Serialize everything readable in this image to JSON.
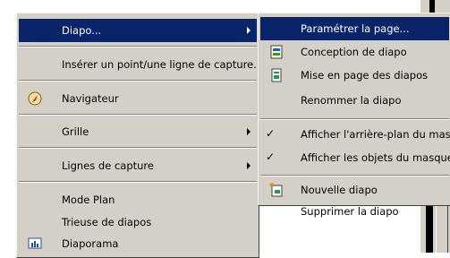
{
  "main_menu": {
    "items": [
      {
        "label": "Diapo...",
        "has_submenu": true,
        "highlighted": true
      },
      {
        "label": "Insérer un point/une ligne de capture..."
      },
      {
        "label": "Navigateur",
        "icon": "navigator-compass-icon"
      },
      {
        "label": "Grille",
        "has_submenu": true
      },
      {
        "label": "Lignes de capture",
        "has_submenu": true
      },
      {
        "label": "Mode Plan"
      },
      {
        "label": "Trieuse de diapos"
      },
      {
        "label": "Diaporama",
        "icon": "slideshow-icon"
      }
    ]
  },
  "sub_menu": {
    "items": [
      {
        "label": "Paramétrer la page...",
        "highlighted": true
      },
      {
        "label": "Conception de diapo",
        "icon": "slide-design-icon"
      },
      {
        "label": "Mise en page des diapos",
        "icon": "slide-layout-icon"
      },
      {
        "label": "Renommer la diapo"
      },
      {
        "label": "Afficher l'arrière-plan du masque",
        "checked": true
      },
      {
        "label": "Afficher les objets du masque",
        "checked": true
      },
      {
        "label": "Nouvelle diapo",
        "icon": "new-slide-icon"
      },
      {
        "label": "Supprimer la diapo"
      }
    ]
  },
  "colors": {
    "menu_bg": "#d4d0c8",
    "highlight": "#0a246a",
    "highlight_text": "#ffffff"
  }
}
